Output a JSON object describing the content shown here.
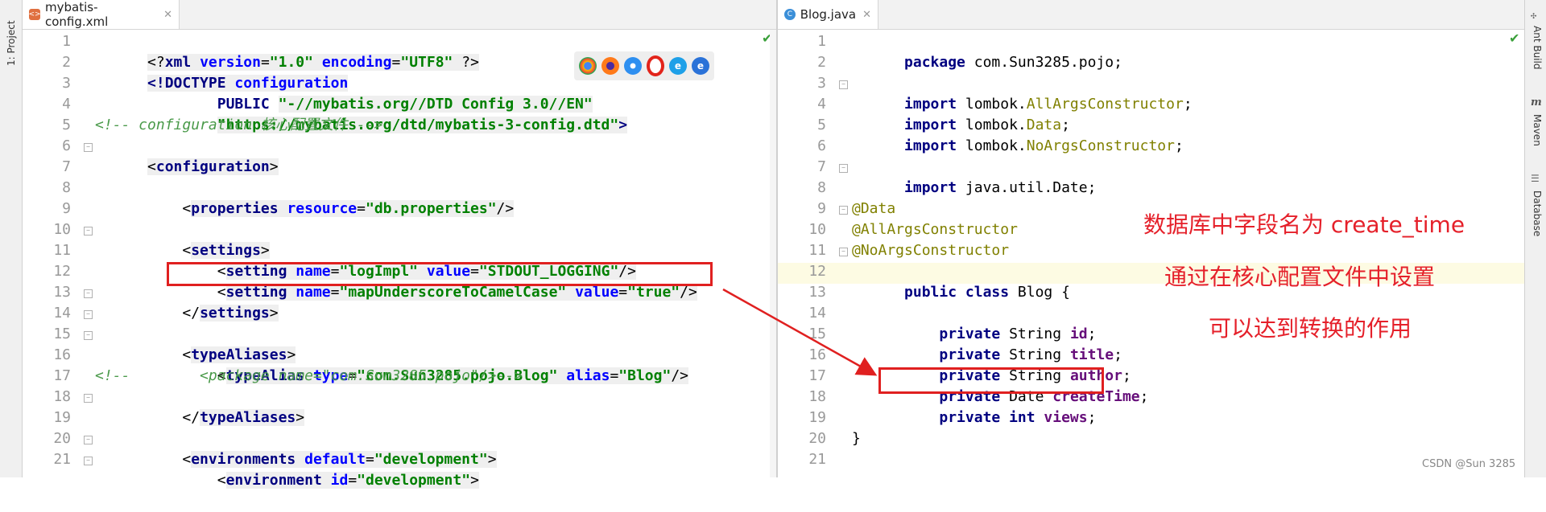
{
  "left_toolwindow": {
    "project_label": "1: Project"
  },
  "right_toolwindow": {
    "ant_label": "Ant Build",
    "maven_label": "Maven",
    "database_label": "Database"
  },
  "left_editor": {
    "tab_title": "mybatis-config.xml",
    "tab_icon": "xml-file-icon",
    "line_numbers": [
      "1",
      "2",
      "3",
      "4",
      "5",
      "6",
      "7",
      "8",
      "9",
      "10",
      "11",
      "12",
      "13",
      "14",
      "15",
      "16",
      "17",
      "18",
      "19",
      "20",
      "21"
    ],
    "lines": {
      "l1": [
        "<?",
        "xml ",
        "version",
        "=",
        "\"1.0\"",
        " ",
        "encoding",
        "=",
        "\"UTF8\"",
        " ?>"
      ],
      "l2": [
        "<!DOCTYPE ",
        "configuration"
      ],
      "l3": [
        "        PUBLIC ",
        "\"-//mybatis.org//DTD Config 3.0//EN\""
      ],
      "l4": [
        "        ",
        "\"https://mybatis.org/dtd/mybatis-3-config.dtd\"",
        ">"
      ],
      "l5": "<!-- configuration 核心配置文件 -->",
      "l6": [
        "<",
        "configuration",
        ">"
      ],
      "l8": [
        "    <",
        "properties",
        " ",
        "resource",
        "=",
        "\"db.properties\"",
        "/>"
      ],
      "l10": [
        "    <",
        "settings",
        ">"
      ],
      "l11": [
        "        <",
        "setting",
        " ",
        "name",
        "=",
        "\"logImpl\"",
        " ",
        "value",
        "=",
        "\"STDOUT_LOGGING\"",
        "/>"
      ],
      "l12": [
        "        <",
        "setting",
        " ",
        "name",
        "=",
        "\"mapUnderscoreToCamelCase\"",
        " ",
        "value",
        "=",
        "\"true\"",
        "/>"
      ],
      "l13": [
        "    </",
        "settings",
        ">"
      ],
      "l15": [
        "    <",
        "typeAliases",
        ">"
      ],
      "l16": [
        "        <",
        "typeAlias",
        " ",
        "type",
        "=",
        "\"com.Sun3285.pojo.Blog\"",
        " ",
        "alias",
        "=",
        "\"Blog\"",
        "/>"
      ],
      "l17": "<!--        <package name=\"com.Sun3285.pojo\"/>-->",
      "l18": [
        "    </",
        "typeAliases",
        ">"
      ],
      "l20": [
        "    <",
        "environments",
        " ",
        "default",
        "=",
        "\"development\"",
        ">"
      ],
      "l21": [
        "        <",
        "environment",
        " ",
        "id",
        "=",
        "\"development\"",
        ">"
      ]
    },
    "browser_icons": [
      "chrome-icon",
      "firefox-icon",
      "safari-icon",
      "opera-icon",
      "ie-icon",
      "edge-icon"
    ]
  },
  "right_editor": {
    "tab_title": "Blog.java",
    "tab_icon": "java-class-icon",
    "line_numbers": [
      "1",
      "2",
      "3",
      "4",
      "5",
      "6",
      "7",
      "8",
      "9",
      "10",
      "11",
      "12",
      "13",
      "14",
      "15",
      "16",
      "17",
      "18",
      "19",
      "20",
      "21"
    ],
    "lines": {
      "l1": [
        "package ",
        "com.Sun3285.pojo;"
      ],
      "l3": [
        "import ",
        "lombok.",
        "AllArgsConstructor",
        ";"
      ],
      "l4": [
        "import ",
        "lombok.",
        "Data",
        ";"
      ],
      "l5": [
        "import ",
        "lombok.",
        "NoArgsConstructor",
        ";"
      ],
      "l7": [
        "import ",
        "java.util.Date;"
      ],
      "l9": "@Data",
      "l10": "@AllArgsConstructor",
      "l11": "@NoArgsConstructor",
      "l12": [
        "public class ",
        "Blog {"
      ],
      "l14": [
        "    private ",
        "String ",
        "id",
        ";"
      ],
      "l15": [
        "    private ",
        "String ",
        "title",
        ";"
      ],
      "l16": [
        "    private ",
        "String ",
        "author",
        ";"
      ],
      "l17": [
        "    private ",
        "Date ",
        "createTime",
        ";"
      ],
      "l18": [
        "    private int ",
        "views",
        ";"
      ],
      "l20": "}"
    }
  },
  "annotations": {
    "note1": "数据库中字段名为 create_time",
    "note2": "通过在核心配置文件中设置",
    "note3": "可以达到转换的作用",
    "color": "#e5202a"
  },
  "watermark": "CSDN @Sun 3285"
}
